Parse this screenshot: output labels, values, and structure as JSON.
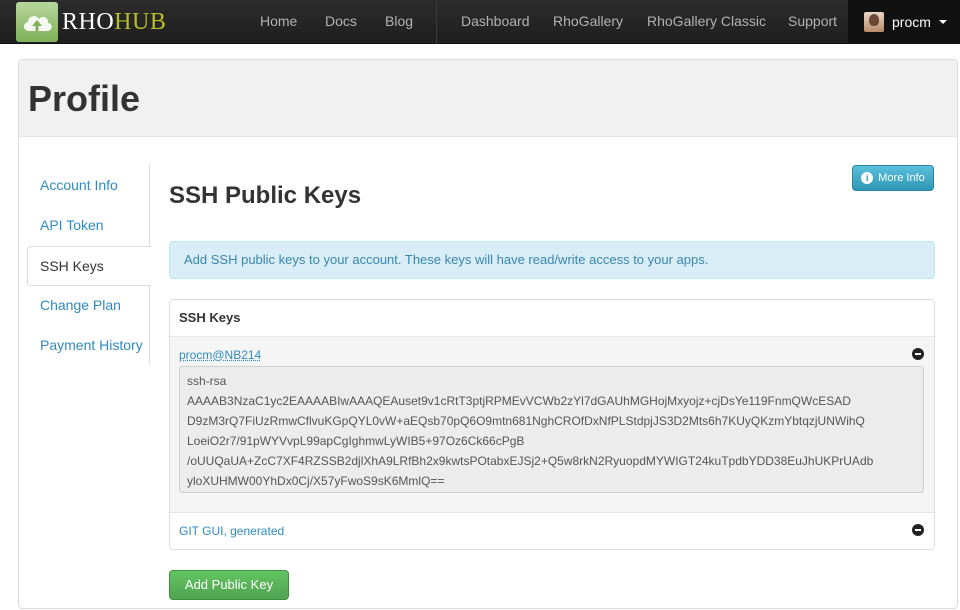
{
  "brand": {
    "rho": "RHO",
    "hub": "HUB"
  },
  "nav": {
    "home": "Home",
    "docs": "Docs",
    "blog": "Blog",
    "dashboard": "Dashboard",
    "rhogallery": "RhoGallery",
    "rhogallery_classic": "RhoGallery Classic",
    "support": "Support"
  },
  "user": {
    "name": "procm"
  },
  "page": {
    "title": "Profile"
  },
  "sidebar": {
    "items": [
      {
        "label": "Account Info"
      },
      {
        "label": "API Token"
      },
      {
        "label": "SSH Keys"
      },
      {
        "label": "Change Plan"
      },
      {
        "label": "Payment History"
      }
    ]
  },
  "content": {
    "title": "SSH Public Keys",
    "more_info": "More Info",
    "alert": "Add SSH public keys to your account. These keys will have read/write access to your apps.",
    "keys_header": "SSH Keys",
    "keys": [
      {
        "name": "procm@NB214",
        "value": "ssh-rsa\nAAAAB3NzaC1yc2EAAAABIwAAAQEAuset9v1cRtT3ptjRPMEvVCWb2zYl7dGAUhMGHojMxyojz+cjDsYe119FnmQWcESAD\nD9zM3rQ7FiUzRmwCflvuKGpQYL0vW+aEQsb70pQ6O9mtn681NghCROfDxNfPLStdpjJS3D2Mts6h7KUyQKzmYbtqzjUNWihQ\nLoeiO2r7/91pWYVvpL99apCgIghmwLyWIB5+97Oz6Ck66cPgB\n/oUUQaUA+ZcC7XF4RZSSB2djlXhA9LRfBh2x9kwtsPOtabxEJSj2+Q5w8rkN2RyuopdMYWIGT24kuTpdbYDD38EuJhUKPrUAdb\nyloXUHMW00YhDx0Cj/X57yFwoS9sK6MmlQ=="
      },
      {
        "name": "GIT GUI, generated"
      }
    ],
    "add_button": "Add Public Key"
  },
  "colors": {
    "link": "#2f8bc1",
    "brand_hub": "#b6bd2a",
    "info_button": "#2f96b4",
    "success_button": "#51a351"
  }
}
